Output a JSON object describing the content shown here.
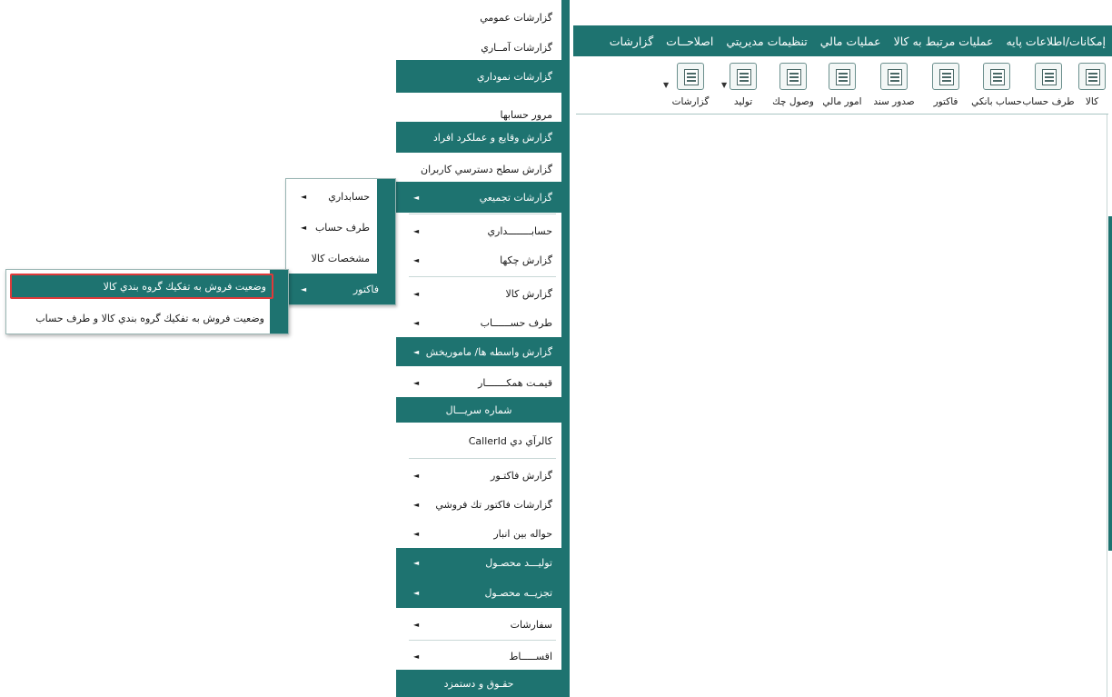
{
  "menubar": {
    "items": [
      "إمكانات/اطلاعات پايه",
      "عمليات مرتبط به كالا",
      "عمليات مالي",
      "تنظيمات مديريتي",
      "اصلاحــات",
      "گزارشات"
    ]
  },
  "toolbar": {
    "items": [
      {
        "label": "كالا",
        "icon": "box-icon"
      },
      {
        "label": "طرف حساب",
        "icon": "person-card-icon"
      },
      {
        "label": "حساب بانكي",
        "icon": "bank-card-icon"
      },
      {
        "label": "فاكتور",
        "icon": "invoice-icon"
      },
      {
        "label": "صدور سند",
        "icon": "document-edit-icon"
      },
      {
        "label": "امور مالي",
        "icon": "calculator-icon"
      },
      {
        "label": "وصول چك",
        "icon": "cheque-icon"
      },
      {
        "label": "توليد",
        "icon": "production-icon"
      },
      {
        "label": "گزارشات",
        "icon": "report-chart-icon"
      }
    ]
  },
  "reports_menu": {
    "items": [
      {
        "label": "گزارشات عمومي",
        "style": "white",
        "arrow": false
      },
      {
        "label": "گزارشات آمــاري",
        "style": "white",
        "arrow": false
      },
      {
        "label": "گزارشات نموداري",
        "style": "teal",
        "arrow": false
      },
      {
        "label": "مرور حسابها",
        "style": "white",
        "arrow": false
      },
      {
        "label": "گزارش وقايع و عملكرد افراد",
        "style": "teal",
        "arrow": false
      },
      {
        "label": "گزارش سطح دسترسي كاربران",
        "style": "white",
        "arrow": false
      },
      {
        "label": "گزارشات تجميعي",
        "style": "teal",
        "arrow": true
      },
      {
        "label": "حسابــــــــداري",
        "style": "white",
        "arrow": true
      },
      {
        "label": "گزارش چكها",
        "style": "white",
        "arrow": true
      },
      {
        "label": "گزارش كالا",
        "style": "white",
        "arrow": true
      },
      {
        "label": "طرف حســــــاب",
        "style": "white",
        "arrow": true
      },
      {
        "label": "گزارش واسطه ها/ ماموريخش",
        "style": "teal",
        "arrow": true
      },
      {
        "label": "قيمـت همكـــــــار",
        "style": "white",
        "arrow": true
      },
      {
        "label": "شماره سريـــال",
        "style": "teal",
        "arrow": false
      },
      {
        "label": "كالرآي دي CallerId",
        "style": "white",
        "arrow": false
      },
      {
        "label": "گزارش فاكتـور",
        "style": "white",
        "arrow": true
      },
      {
        "label": "گزارشات فاكتور تك فروشي",
        "style": "white",
        "arrow": true
      },
      {
        "label": "حواله بين انبار",
        "style": "white",
        "arrow": true
      },
      {
        "label": "توليـــد محصـول",
        "style": "teal",
        "arrow": true
      },
      {
        "label": "تجزيــه محصـول",
        "style": "teal",
        "arrow": true
      },
      {
        "label": "سفارشات",
        "style": "white",
        "arrow": true
      },
      {
        "label": "اقســـــاط",
        "style": "white",
        "arrow": true
      },
      {
        "label": "حقـوق و دستمزد",
        "style": "teal",
        "arrow": false
      }
    ]
  },
  "aggregate_submenu": {
    "items": [
      {
        "label": "حسابداري",
        "arrow": true
      },
      {
        "label": "طرف حساب",
        "arrow": true
      },
      {
        "label": "مشخصات كالا",
        "arrow": false
      },
      {
        "label": "فاكتور",
        "arrow": true,
        "active": true
      }
    ]
  },
  "invoice_submenu": {
    "items": [
      {
        "label": "وضعيت فروش به تفكيك گروه بندي كالا",
        "active": true
      },
      {
        "label": "وضعيت فروش به تفكيك گروه بندي كالا و طرف حساب",
        "active": false
      }
    ]
  },
  "colors": {
    "accent": "#1e7370",
    "highlight_border": "#e03a3a"
  }
}
